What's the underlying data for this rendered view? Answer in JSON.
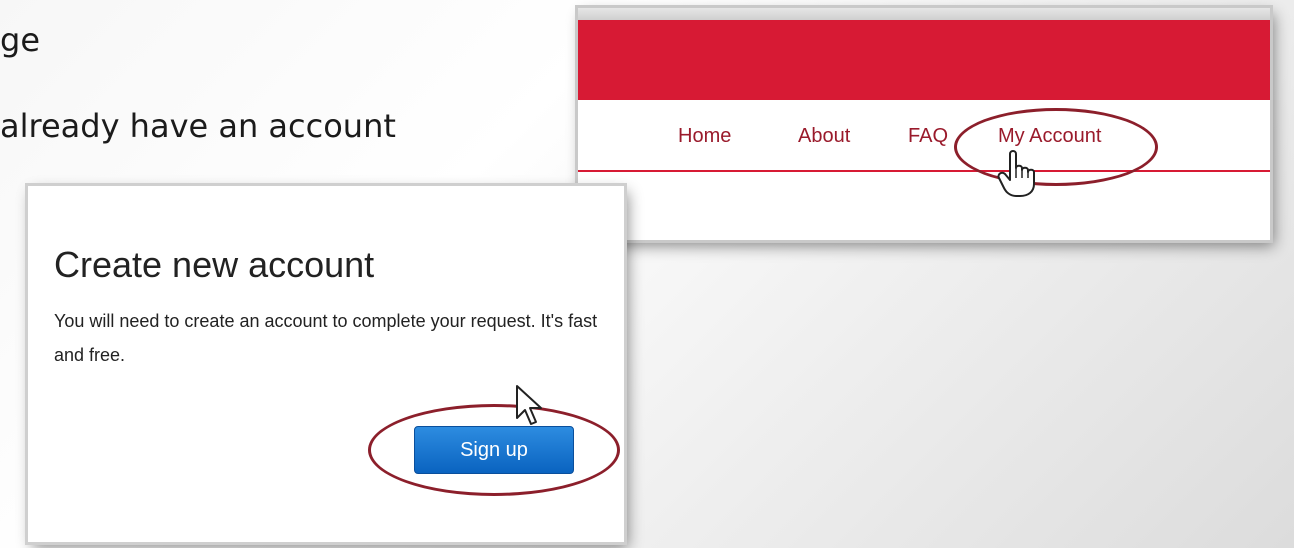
{
  "slide": {
    "line1": "ge",
    "line2": "already have an account"
  },
  "nav_screenshot": {
    "links": {
      "home": "Home",
      "about": "About",
      "faq": "FAQ",
      "my_account": "My Account"
    },
    "colors": {
      "accent": "#d71a34",
      "link": "#9a1a2b",
      "highlight_oval": "#8c1f2b"
    },
    "cursor_icon": "hand-pointer-icon"
  },
  "create_account_screenshot": {
    "title": "Create new account",
    "description": "You will need to create an account to complete your request. It's fast and free.",
    "button_label": "Sign up",
    "colors": {
      "button": "#0a63c0",
      "highlight_oval": "#8c1f2b"
    },
    "cursor_icon": "arrow-pointer-icon"
  }
}
